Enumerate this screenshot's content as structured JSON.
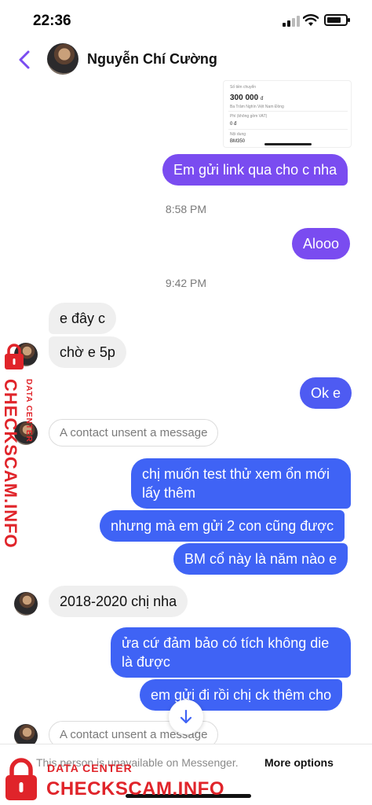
{
  "status_bar": {
    "time": "22:36"
  },
  "header": {
    "contact_name": "Nguyễn Chí Cường"
  },
  "shared_image": {
    "label1": "Số tiền chuyển",
    "amount": "300 000",
    "currency": "đ",
    "label2": "Ba Trăm Nghìn Việt Nam Đồng",
    "fee_label": "Phí (không gồm VAT)",
    "fee": "0 đ",
    "content_label": "Nội dung",
    "content": "BM350"
  },
  "messages": [
    {
      "text": "Em gửi link qua cho c nha"
    },
    {
      "timestamp": "8:58 PM"
    },
    {
      "text": "Alooo"
    },
    {
      "timestamp": "9:42 PM"
    },
    {
      "text": "e đây c"
    },
    {
      "text": "chờ e 5p"
    },
    {
      "text": "Ok e"
    },
    {
      "unsent": "A contact unsent a message"
    },
    {
      "text": "chị muốn test thử xem ổn mới",
      "text2": "lấy thêm"
    },
    {
      "text": "nhưng mà em gửi 2 con cũng được"
    },
    {
      "text": "BM cổ này là năm nào e"
    },
    {
      "text": "2018-2020 chị nha"
    },
    {
      "text": "ửa cứ đảm bảo có tích không die",
      "text2": "là được"
    },
    {
      "text": "em gửi đi rồi chị ck thêm cho"
    },
    {
      "unsent": "A contact unsent a message"
    }
  ],
  "footer": {
    "unavailable": "This person is unavailable on Messenger.",
    "more_options": "More options"
  },
  "watermark": {
    "data_center": "DATA CENTER",
    "checkscam": "CHECKSCAM.INFO"
  },
  "colors": {
    "purple": "#7a4cf0",
    "indigo": "#4e5bf2",
    "blue": "#3f63f5",
    "incoming": "#efefef",
    "watermark_red": "#e0242a"
  },
  "icons": [
    "back-chevron-icon",
    "signal-icon",
    "wifi-icon",
    "battery-icon",
    "arrow-down-icon",
    "lock-icon"
  ]
}
